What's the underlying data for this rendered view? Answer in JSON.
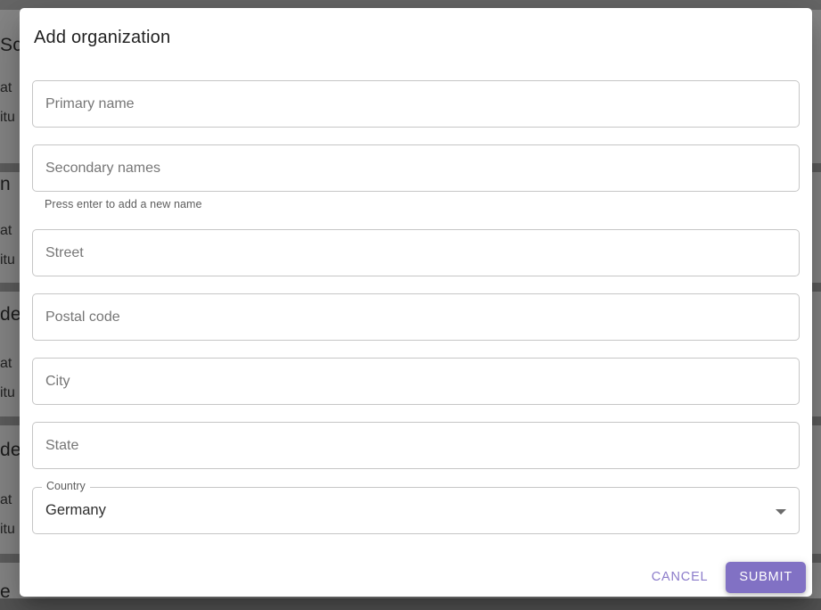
{
  "backdrop": {
    "fragments": [
      {
        "text": "Sc"
      },
      {
        "text": "at"
      },
      {
        "text": "itu"
      },
      {
        "text": "n"
      },
      {
        "text": "at"
      },
      {
        "text": "itu"
      },
      {
        "text": "de"
      },
      {
        "text": "at"
      },
      {
        "text": "itu"
      },
      {
        "text": "de"
      },
      {
        "text": "at"
      },
      {
        "text": "itu"
      },
      {
        "text": "e"
      }
    ]
  },
  "dialog": {
    "title": "Add organization",
    "fields": [
      {
        "placeholder": "Primary name"
      },
      {
        "placeholder": "Secondary names",
        "helper": "Press enter to add a new name"
      },
      {
        "placeholder": "Street"
      },
      {
        "placeholder": "Postal code"
      },
      {
        "placeholder": "City"
      },
      {
        "placeholder": "State"
      }
    ],
    "country": {
      "label": "Country",
      "value": "Germany"
    },
    "actions": {
      "cancel": "CANCEL",
      "submit": "SUBMIT"
    },
    "icons": {
      "country_dropdown": "chevron-down"
    },
    "colors": {
      "submit_background": "#8171c4",
      "cancel_text": "#8c7cca",
      "field_border": "#c6c6c6",
      "placeholder_text": "#767676"
    }
  }
}
